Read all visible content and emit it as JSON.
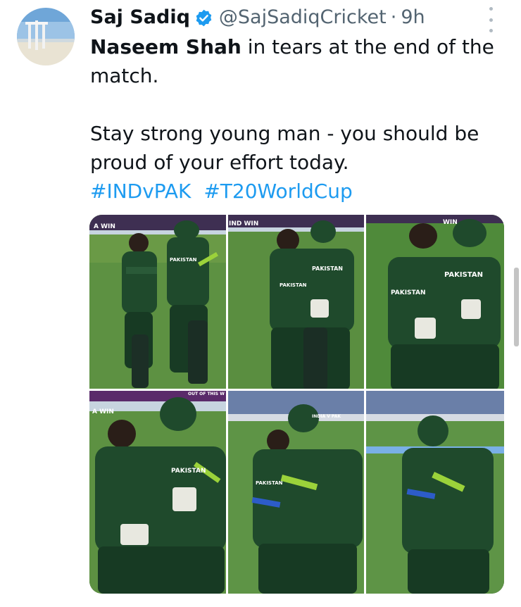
{
  "author": {
    "name": "Saj Sadiq",
    "handle": "@SajSadiqCricket",
    "separator": "·",
    "time": "9h",
    "verified_icon": "verified-badge-icon",
    "verified_color": "#1d9bf0"
  },
  "tweet": {
    "line1_bold": "Naseem Shah",
    "line1_rest": " in tears at the end of the match.",
    "line2": "Stay strong young man - you should be proud of your effort today.",
    "hashtags": [
      "#INDvPAK",
      "#T20WorldCup"
    ],
    "hashtag_color": "#1d9bf0"
  },
  "media": {
    "board_texts": [
      "A WIN",
      "IND WIN",
      "IND",
      "WIN",
      "A WIN",
      "OUT OF THIS W",
      "INDIA V PAK"
    ],
    "shirt_texts": [
      "PAKISTAN",
      "PAKISTAN",
      "PAKISTAN",
      "PAKISTAN",
      "PAKISTAN",
      "PAKISTAN",
      "PAKISTAN",
      "PAKISTAN"
    ]
  },
  "colors": {
    "text": "#0f1419",
    "secondary": "#536471",
    "link": "#1d9bf0",
    "jersey": "#1f4a2c",
    "grass": "#5b8f3c"
  }
}
